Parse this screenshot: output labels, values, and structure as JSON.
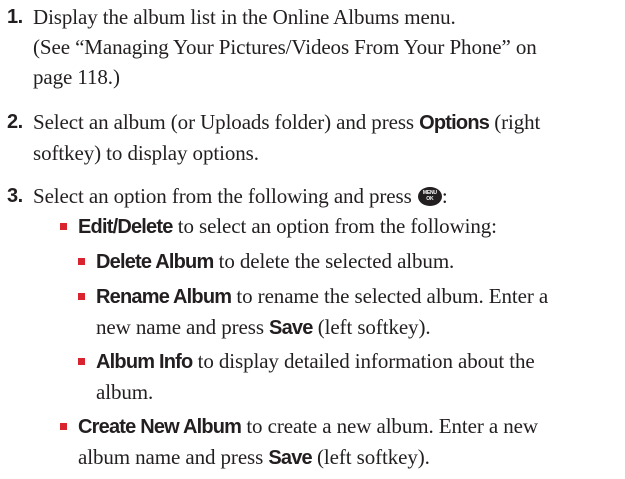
{
  "steps": [
    {
      "number": "1.",
      "lines": [
        "Display the album list in the Online Albums menu.",
        "(See “Managing Your Pictures/Videos From Your Phone” on",
        "page 118.)"
      ]
    },
    {
      "number": "2.",
      "line1_before": "Select an album (or Uploads folder) and press ",
      "line1_keyword": "Options",
      "line1_after": " (right",
      "line2": "softkey) to display options."
    },
    {
      "number": "3.",
      "text": "Select an option from the following and press ",
      "key_icon": "menu-ok-key-icon",
      "key_icon_top": "MENU",
      "key_icon_bottom": "OK",
      "after_icon": ":",
      "items": [
        {
          "keyword": "Edit/Delete",
          "text": " to select an option from the following:",
          "subitems": [
            {
              "keyword": "Delete Album",
              "line1": " to delete the selected album."
            },
            {
              "keyword": "Rename Album",
              "line1": " to rename the selected album. Enter a",
              "line2_before": "new name and press ",
              "line2_keyword": "Save",
              "line2_after": " (left softkey)."
            },
            {
              "keyword": "Album Info",
              "line1": " to display detailed information about the",
              "line2": "album."
            }
          ]
        },
        {
          "keyword": "Create New Album",
          "line1": " to create a new album. Enter a new",
          "line2_before": "album name and press ",
          "line2_keyword": "Save",
          "line2_after": " (left softkey)."
        }
      ]
    }
  ],
  "colors": {
    "text": "#231f20",
    "bullet": "#d9232e"
  }
}
